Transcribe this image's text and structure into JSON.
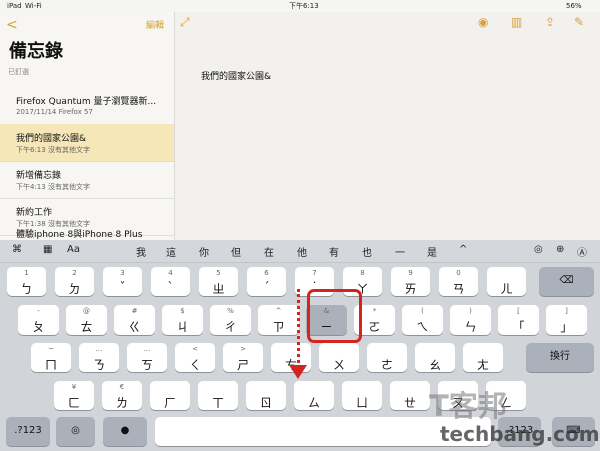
{
  "status": {
    "device": "iPad",
    "wifi": "Wi-Fi",
    "time": "下午6:13",
    "battery": "56%"
  },
  "sidebar": {
    "back": "<",
    "edit": "編輯",
    "title": "備忘錄",
    "pinned": "已釘選",
    "notes": [
      {
        "title": "Firefox Quantum 量子瀏覽器新...",
        "subtitle": "2017/11/14  Firefox 57"
      },
      {
        "title": "我們的國家公園&",
        "subtitle": "下午6:13  沒有其他文字"
      },
      {
        "title": "新增備忘錄",
        "subtitle": "下午4:13  沒有其他文字"
      },
      {
        "title": "新約工作",
        "subtitle": "下午1:38  沒有其他文字"
      },
      {
        "title": "體驗iphone 8與iPhone 8 Plus",
        "subtitle": ""
      }
    ]
  },
  "editor": {
    "text": "我們的國家公園&"
  },
  "toolbar": {
    "left": [
      "⌘",
      "▦",
      "Aa"
    ],
    "candidates": [
      "我",
      "這",
      "你",
      "但",
      "在",
      "他",
      "有",
      "也",
      "一",
      "是",
      "^"
    ],
    "right": [
      "◎",
      "⊕",
      "Ⓐ"
    ]
  },
  "keyboard": {
    "row1": [
      [
        "1",
        "ㄅ"
      ],
      [
        "2",
        "ㄉ"
      ],
      [
        "3",
        "ˇ"
      ],
      [
        "4",
        "ˋ"
      ],
      [
        "5",
        "ㄓ"
      ],
      [
        "6",
        "ˊ"
      ],
      [
        "7",
        "˙"
      ],
      [
        "8",
        "ㄚ"
      ],
      [
        "9",
        "ㄞ"
      ],
      [
        "0",
        "ㄢ"
      ],
      [
        "",
        "ㄦ"
      ]
    ],
    "row2": [
      [
        "-",
        "ㄆ"
      ],
      [
        "@",
        "ㄊ"
      ],
      [
        "#",
        "ㄍ"
      ],
      [
        "$",
        "ㄐ"
      ],
      [
        "%",
        "ㄔ"
      ],
      [
        "^",
        "ㄗ"
      ],
      [
        "&",
        "ㄧ"
      ],
      [
        "*",
        "ㄛ"
      ],
      [
        "(",
        "ㄟ"
      ],
      [
        ")",
        "ㄣ"
      ],
      [
        "[",
        "「"
      ],
      [
        "]",
        "」"
      ]
    ],
    "row3": [
      [
        "~",
        "ㄇ"
      ],
      [
        "…",
        "ㄋ"
      ],
      [
        "...",
        "ㄎ"
      ],
      [
        "<",
        "ㄑ"
      ],
      [
        ">",
        "ㄕ"
      ],
      [
        "",
        "ㄘ"
      ],
      [
        "",
        "ㄨ"
      ],
      [
        "",
        "ㄜ"
      ],
      [
        "",
        "ㄠ"
      ],
      [
        "",
        "ㄤ"
      ]
    ],
    "row4": [
      [
        "¥",
        "ㄈ"
      ],
      [
        "€",
        "ㄌ"
      ],
      [
        "",
        "ㄏ"
      ],
      [
        "",
        "ㄒ"
      ],
      [
        "",
        "ㄖ"
      ],
      [
        "",
        "ㄙ"
      ],
      [
        "",
        "ㄩ"
      ],
      [
        "",
        "ㄝ"
      ],
      [
        "",
        "ㄡ"
      ],
      [
        "",
        "ㄥ"
      ]
    ],
    "delete": "⌫",
    "return": "換行",
    "switch_left": ".?123",
    "globe": "◎",
    "mic": "●",
    "space": "",
    "switch_right": ".?123",
    "hide": "⌨"
  },
  "watermark": {
    "top": "T客邦",
    "bottom": "techbang.com"
  }
}
